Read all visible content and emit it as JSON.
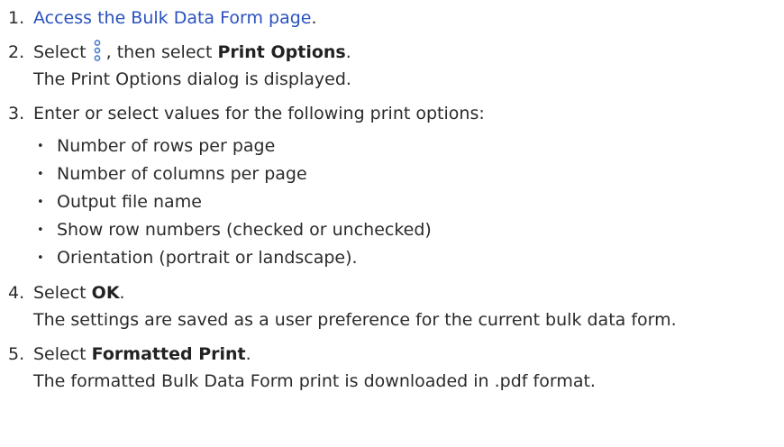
{
  "steps": [
    {
      "number": "1.",
      "link_text": "Access the Bulk Data Form page",
      "after": "."
    },
    {
      "number": "2.",
      "before": "Select",
      "icon": "more-options-icon",
      "middle": ", then select",
      "bold": "Print Options",
      "after": ".",
      "result": "The Print Options dialog is displayed."
    },
    {
      "number": "3.",
      "text": "Enter or select values for the following print options:",
      "bullets": [
        "Number of rows per page",
        "Number of columns per page",
        "Output file name",
        "Show row numbers (checked or unchecked)",
        "Orientation (portrait or landscape)."
      ]
    },
    {
      "number": "4.",
      "before": "Select",
      "bold": "OK",
      "after": ".",
      "result": "The settings are saved as a user preference for the current bulk data form."
    },
    {
      "number": "5.",
      "before": "Select",
      "bold": "Formatted Print",
      "after": ".",
      "result": "The formatted Bulk Data Form print is downloaded in .pdf format."
    }
  ],
  "colors": {
    "link": "#2a52be",
    "icon": "#4a7fcf",
    "text": "#2b2b2b"
  }
}
